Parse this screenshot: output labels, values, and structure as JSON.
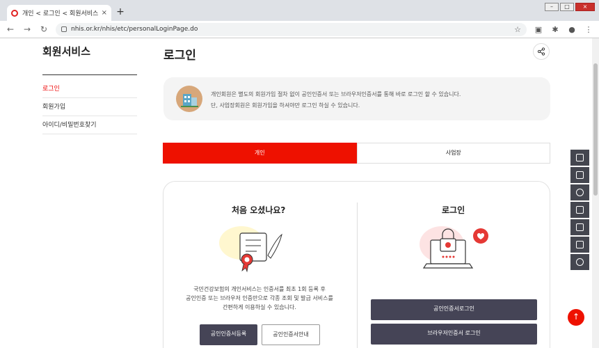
{
  "browser": {
    "tab_title": "개인 < 로그인 < 회원서비스 <",
    "tab_close": "×",
    "new_tab": "+",
    "url": "nhis.or.kr/nhis/etc/personalLoginPage.do",
    "window_min": "–",
    "window_max": "□",
    "window_close": "×",
    "back": "←",
    "forward": "→",
    "reload": "↻",
    "star": "☆"
  },
  "sidebar": {
    "title": "회원서비스",
    "items": [
      {
        "label": "로그인"
      },
      {
        "label": "회원가입"
      },
      {
        "label": "아이디/비밀번호찾기"
      }
    ]
  },
  "main": {
    "title": "로그인",
    "notice": {
      "line1": "개인회원은 별도의 회원가입 절차 없이 공인인증서 또는 브라우저인증서를 통해 바로 로그인 할 수 있습니다.",
      "line2": "단, 사업장회원은 회원가입을 하셔야만 로그인 하실 수 있습니다."
    },
    "tabs": [
      {
        "label": "개인"
      },
      {
        "label": "사업장"
      }
    ],
    "first_visit": {
      "title": "처음 오셨나요?",
      "desc1": "국민건강보험의 개인서비스는 인증서를 최초 1회 등록 후",
      "desc2": "공인인증 또는 브라우저 인증만으로 각종 조회 및 발급 서비스를",
      "desc3": "간편하게 이용하실 수 있습니다.",
      "register_btn": "공인인증서등록",
      "guide_btn": "공인인증서안내"
    },
    "login": {
      "title": "로그인",
      "cert_btn": "공인인증서로그인",
      "browser_btn": "브라우저인증서 로그인"
    }
  },
  "quickmenu": [
    "doc-icon",
    "monitor-icon",
    "headset-icon",
    "lock-icon",
    "list-icon",
    "layers-icon",
    "chat-icon"
  ],
  "top_button": "↑",
  "colors": {
    "accent": "#ee1100",
    "dark_button": "#454456"
  }
}
